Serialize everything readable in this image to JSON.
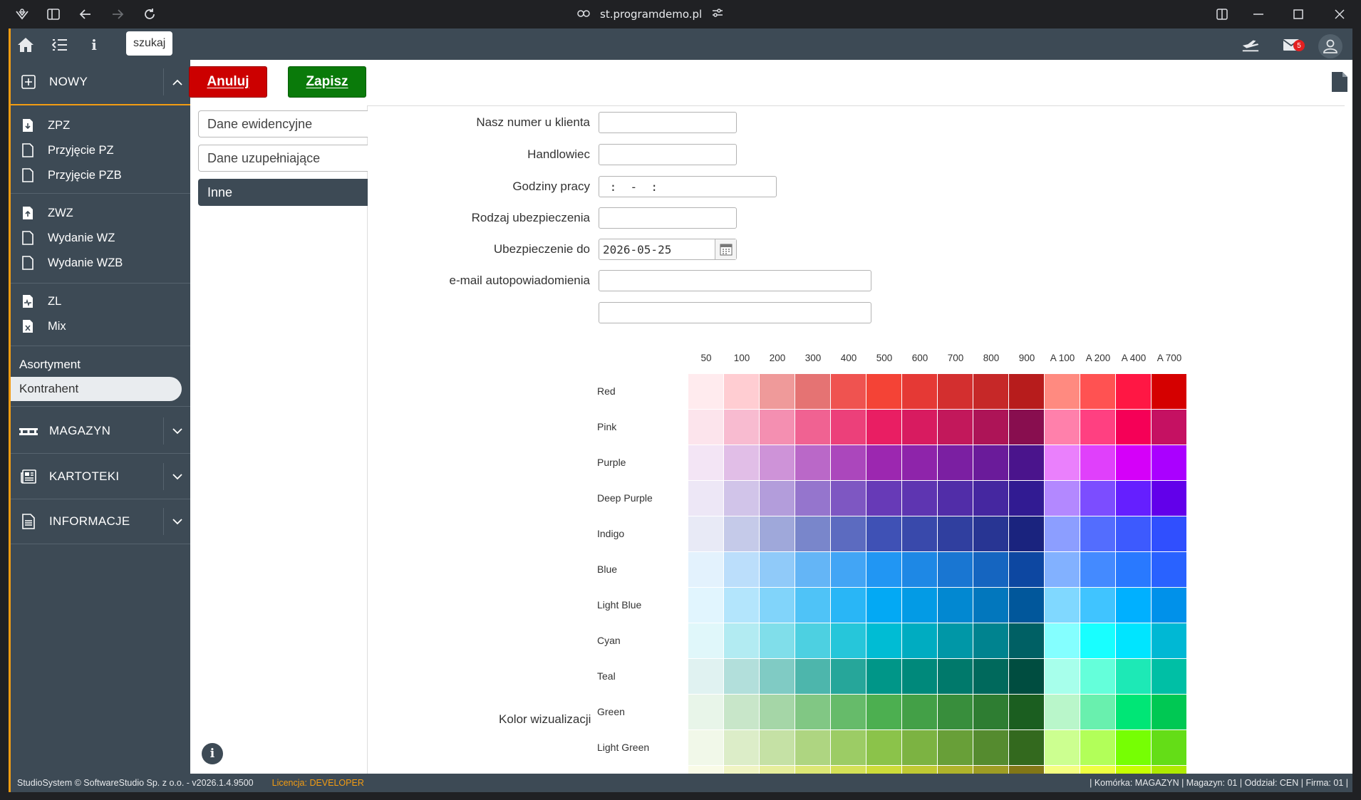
{
  "browser": {
    "url": "st.programdemo.pl"
  },
  "topbar": {
    "search_label": "szukaj",
    "mail_count": "5"
  },
  "sidebar": {
    "sections": [
      {
        "label": "NOWY"
      },
      {
        "label": "MAGAZYN"
      },
      {
        "label": "KARTOTEKI"
      },
      {
        "label": "INFORMACJE"
      }
    ],
    "items": [
      {
        "label": "ZPZ"
      },
      {
        "label": "Przyjęcie PZ"
      },
      {
        "label": "Przyjęcie PZB"
      },
      {
        "label": "ZWZ"
      },
      {
        "label": "Wydanie WZ"
      },
      {
        "label": "Wydanie WZB"
      },
      {
        "label": "ZL"
      },
      {
        "label": "Mix"
      }
    ],
    "plain": [
      {
        "label": "Asortyment"
      },
      {
        "label": "Kontrahent"
      }
    ]
  },
  "toolbar": {
    "cancel_label": "Anuluj",
    "save_label": "Zapisz"
  },
  "tabs": [
    {
      "label": "Dane ewidencyjne"
    },
    {
      "label": "Dane uzupełniające"
    },
    {
      "label": "Inne"
    }
  ],
  "form": {
    "client_number": {
      "label": "Nasz numer u klienta",
      "value": ""
    },
    "salesman": {
      "label": "Handlowiec",
      "value": ""
    },
    "work_hours": {
      "label": "Godziny pracy",
      "value": " :  -  : "
    },
    "insurance_type": {
      "label": "Rodzaj ubezpieczenia",
      "value": ""
    },
    "insurance_until": {
      "label": "Ubezpieczenie do",
      "value": "2026-05-25"
    },
    "notify_email": {
      "label": "e-mail autopowiadomienia",
      "value": ""
    },
    "notify_email_2": {
      "value": ""
    },
    "color_label": "Kolor wizualizacji"
  },
  "palette": {
    "columns": [
      "50",
      "100",
      "200",
      "300",
      "400",
      "500",
      "600",
      "700",
      "800",
      "900",
      "A 100",
      "A 200",
      "A 400",
      "A 700"
    ],
    "rows": [
      {
        "name": "Red",
        "colors": [
          "#ffebee",
          "#ffcdd2",
          "#ef9a9a",
          "#e57373",
          "#ef5350",
          "#f44336",
          "#e53935",
          "#d32f2f",
          "#c62828",
          "#b71c1c",
          "#ff8a80",
          "#ff5252",
          "#ff1744",
          "#d50000"
        ]
      },
      {
        "name": "Pink",
        "colors": [
          "#fce4ec",
          "#f8bbd0",
          "#f48fb1",
          "#f06292",
          "#ec407a",
          "#e91e63",
          "#d81b60",
          "#c2185b",
          "#ad1457",
          "#880e4f",
          "#ff80ab",
          "#ff4081",
          "#f50057",
          "#c51162"
        ]
      },
      {
        "name": "Purple",
        "colors": [
          "#f3e5f5",
          "#e1bee7",
          "#ce93d8",
          "#ba68c8",
          "#ab47bc",
          "#9c27b0",
          "#8e24aa",
          "#7b1fa2",
          "#6a1b9a",
          "#4a148c",
          "#ea80fc",
          "#e040fb",
          "#d500f9",
          "#aa00ff"
        ]
      },
      {
        "name": "Deep Purple",
        "colors": [
          "#ede7f6",
          "#d1c4e9",
          "#b39ddb",
          "#9575cd",
          "#7e57c2",
          "#673ab7",
          "#5e35b1",
          "#512da8",
          "#4527a0",
          "#311b92",
          "#b388ff",
          "#7c4dff",
          "#651fff",
          "#6200ea"
        ]
      },
      {
        "name": "Indigo",
        "colors": [
          "#e8eaf6",
          "#c5cae9",
          "#9fa8da",
          "#7986cb",
          "#5c6bc0",
          "#3f51b5",
          "#3949ab",
          "#303f9f",
          "#283593",
          "#1a237e",
          "#8c9eff",
          "#536dfe",
          "#3d5afe",
          "#304ffe"
        ]
      },
      {
        "name": "Blue",
        "colors": [
          "#e3f2fd",
          "#bbdefb",
          "#90caf9",
          "#64b5f6",
          "#42a5f5",
          "#2196f3",
          "#1e88e5",
          "#1976d2",
          "#1565c0",
          "#0d47a1",
          "#82b1ff",
          "#448aff",
          "#2979ff",
          "#2962ff"
        ]
      },
      {
        "name": "Light Blue",
        "colors": [
          "#e1f5fe",
          "#b3e5fc",
          "#81d4fa",
          "#4fc3f7",
          "#29b6f6",
          "#03a9f4",
          "#039be5",
          "#0288d1",
          "#0277bd",
          "#01579b",
          "#80d8ff",
          "#40c4ff",
          "#00b0ff",
          "#0091ea"
        ]
      },
      {
        "name": "Cyan",
        "colors": [
          "#e0f7fa",
          "#b2ebf2",
          "#80deea",
          "#4dd0e1",
          "#26c6da",
          "#00bcd4",
          "#00acc1",
          "#0097a7",
          "#00838f",
          "#006064",
          "#84ffff",
          "#18ffff",
          "#00e5ff",
          "#00b8d4"
        ]
      },
      {
        "name": "Teal",
        "colors": [
          "#e0f2f1",
          "#b2dfdb",
          "#80cbc4",
          "#4db6ac",
          "#26a69a",
          "#009688",
          "#00897b",
          "#00796b",
          "#00695c",
          "#004d40",
          "#a7ffeb",
          "#64ffda",
          "#1de9b6",
          "#00bfa5"
        ]
      },
      {
        "name": "Green",
        "colors": [
          "#e8f5e9",
          "#c8e6c9",
          "#a5d6a7",
          "#81c784",
          "#66bb6a",
          "#4caf50",
          "#43a047",
          "#388e3c",
          "#2e7d32",
          "#1b5e20",
          "#b9f6ca",
          "#69f0ae",
          "#00e676",
          "#00c853"
        ]
      },
      {
        "name": "Light Green",
        "colors": [
          "#f1f8e9",
          "#dcedc8",
          "#c5e1a5",
          "#aed581",
          "#9ccc65",
          "#8bc34a",
          "#7cb342",
          "#689f38",
          "#558b2f",
          "#33691e",
          "#ccff90",
          "#b2ff59",
          "#76ff03",
          "#64dd17"
        ]
      },
      {
        "name": "",
        "colors": [
          "#f9fbe7",
          "#f0f4c3",
          "#e6ee9c",
          "#dce775",
          "#d4e157",
          "#cddc39",
          "#c0ca33",
          "#afb42b",
          "#9e9d24",
          "#827717",
          "#f4ff81",
          "#eeff41",
          "#c6ff00",
          "#aeea00"
        ]
      }
    ]
  },
  "status": {
    "copyright": "StudioSystem © SoftwareStudio Sp. z o.o. - v2026.1.4.9500",
    "license_prefix": "Licencja: ",
    "license_value": "DEVELOPER",
    "context": "| Komórka: MAGAZYN | Magazyn: 01 | Oddział: CEN | Firma: 01 |"
  }
}
